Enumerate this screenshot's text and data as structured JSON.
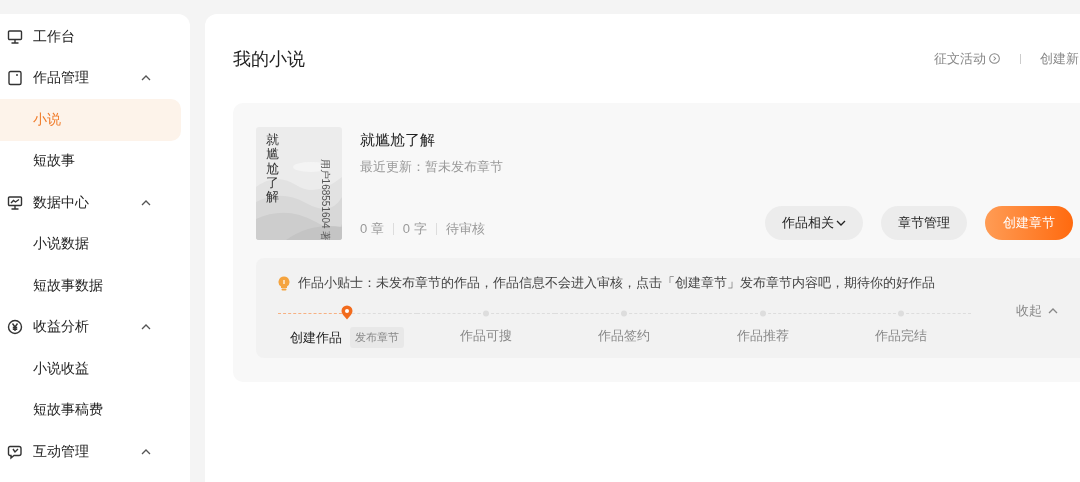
{
  "sidebar": {
    "items": [
      {
        "label": "工作台",
        "selected": false
      },
      {
        "label": "作品管理",
        "expanded": true,
        "children": [
          {
            "label": "小说",
            "selected": true
          },
          {
            "label": "短故事",
            "selected": false
          }
        ]
      },
      {
        "label": "数据中心",
        "expanded": true,
        "children": [
          {
            "label": "小说数据",
            "selected": false
          },
          {
            "label": "短故事数据",
            "selected": false
          }
        ]
      },
      {
        "label": "收益分析",
        "expanded": true,
        "children": [
          {
            "label": "小说收益",
            "selected": false
          },
          {
            "label": "短故事稿费",
            "selected": false
          }
        ]
      },
      {
        "label": "互动管理",
        "expanded": true
      }
    ]
  },
  "header": {
    "title": "我的小说",
    "links": [
      {
        "label": "征文活动",
        "kind": "arrow-link"
      },
      {
        "label": "创建新",
        "kind": "link"
      }
    ]
  },
  "novel": {
    "title": "就尴尬了解",
    "cover": {
      "title": "就尴尬了解",
      "author": "用户168551604 著"
    },
    "update": "最近更新：暂未发布章节",
    "stats": [
      "0 章",
      "0 字",
      "待审核"
    ],
    "buttons": [
      {
        "label": "作品相关",
        "kind": "dropdown"
      },
      {
        "label": "章节管理",
        "kind": "secondary"
      },
      {
        "label": "创建章节",
        "kind": "primary"
      }
    ]
  },
  "tip": {
    "text": "作品小贴士：未发布章节的作品，作品信息不会进入审核，点击「创建章节」发布章节内容吧，期待你的好作品",
    "collapse": "收起",
    "steps": [
      {
        "label": "创建作品",
        "current": true,
        "tag": "发布章节"
      },
      {
        "label": "作品可搜",
        "current": false
      },
      {
        "label": "作品签约",
        "current": false
      },
      {
        "label": "作品推荐",
        "current": false
      },
      {
        "label": "作品完结",
        "current": false
      }
    ]
  }
}
